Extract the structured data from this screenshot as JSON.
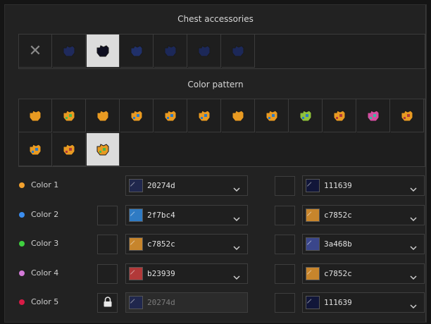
{
  "accessories": {
    "title": "Chest accessories",
    "items": [
      {
        "name": "none",
        "selected": false
      },
      {
        "name": "item-1",
        "color": "#1f2a5c",
        "selected": false
      },
      {
        "name": "item-2",
        "color": "#0e0e20",
        "selected": true
      },
      {
        "name": "item-3",
        "color": "#20306a",
        "selected": false
      },
      {
        "name": "item-4",
        "color": "#1c2858",
        "selected": false
      },
      {
        "name": "item-5",
        "color": "#1c2858",
        "selected": false
      },
      {
        "name": "item-6",
        "color": "#1c2858",
        "selected": false
      }
    ]
  },
  "patterns": {
    "title": "Color pattern",
    "items": [
      {
        "primary": "#e89a22",
        "secondary": "#e89a22",
        "selected": false
      },
      {
        "primary": "#e89a22",
        "secondary": "#4fb84a",
        "selected": false
      },
      {
        "primary": "#e89a22",
        "secondary": "#e89a22",
        "selected": false
      },
      {
        "primary": "#e89a22",
        "secondary": "#2f7bc4",
        "selected": false
      },
      {
        "primary": "#e89a22",
        "secondary": "#2f7bc4",
        "selected": false
      },
      {
        "primary": "#e89a22",
        "secondary": "#2f7bc4",
        "selected": false
      },
      {
        "primary": "#e89a22",
        "secondary": "#e89a22",
        "selected": false
      },
      {
        "primary": "#e89a22",
        "secondary": "#2f7bc4",
        "selected": false
      },
      {
        "primary": "#8fc13b",
        "secondary": "#2f7bc4",
        "selected": false
      },
      {
        "primary": "#e89a22",
        "secondary": "#b23939",
        "selected": false
      },
      {
        "primary": "#d44ea0",
        "secondary": "#3fb8a0",
        "selected": false
      },
      {
        "primary": "#e89a22",
        "secondary": "#b23939",
        "selected": false
      },
      {
        "primary": "#e89a22",
        "secondary": "#2f7bc4",
        "selected": false
      },
      {
        "primary": "#e89a22",
        "secondary": "#b23939",
        "selected": false
      },
      {
        "primary": "#e89a22",
        "secondary": "#4fb84a",
        "selected": true
      }
    ]
  },
  "colors": [
    {
      "label": "Color 1",
      "dot": "#f2a12e",
      "lockable": false,
      "locked": false,
      "left": {
        "hex": "20274d",
        "swatch": "#20274d",
        "disabled": false
      },
      "right": {
        "hex": "111639",
        "swatch": "#111639"
      }
    },
    {
      "label": "Color 2",
      "dot": "#3b8ef0",
      "lockable": true,
      "locked": false,
      "left": {
        "hex": "2f7bc4",
        "swatch": "#2f7bc4",
        "disabled": false
      },
      "right": {
        "hex": "c7852c",
        "swatch": "#c7852c"
      }
    },
    {
      "label": "Color 3",
      "dot": "#3fcf3f",
      "lockable": true,
      "locked": false,
      "left": {
        "hex": "c7852c",
        "swatch": "#c7852c",
        "disabled": false
      },
      "right": {
        "hex": "3a468b",
        "swatch": "#3a468b"
      }
    },
    {
      "label": "Color 4",
      "dot": "#d37ad8",
      "lockable": true,
      "locked": false,
      "left": {
        "hex": "b23939",
        "swatch": "#b23939",
        "disabled": false
      },
      "right": {
        "hex": "c7852c",
        "swatch": "#c7852c"
      }
    },
    {
      "label": "Color 5",
      "dot": "#d81b46",
      "lockable": true,
      "locked": true,
      "left": {
        "hex": "20274d",
        "swatch": "#20274d",
        "disabled": true
      },
      "right": {
        "hex": "111639",
        "swatch": "#111639"
      }
    }
  ]
}
